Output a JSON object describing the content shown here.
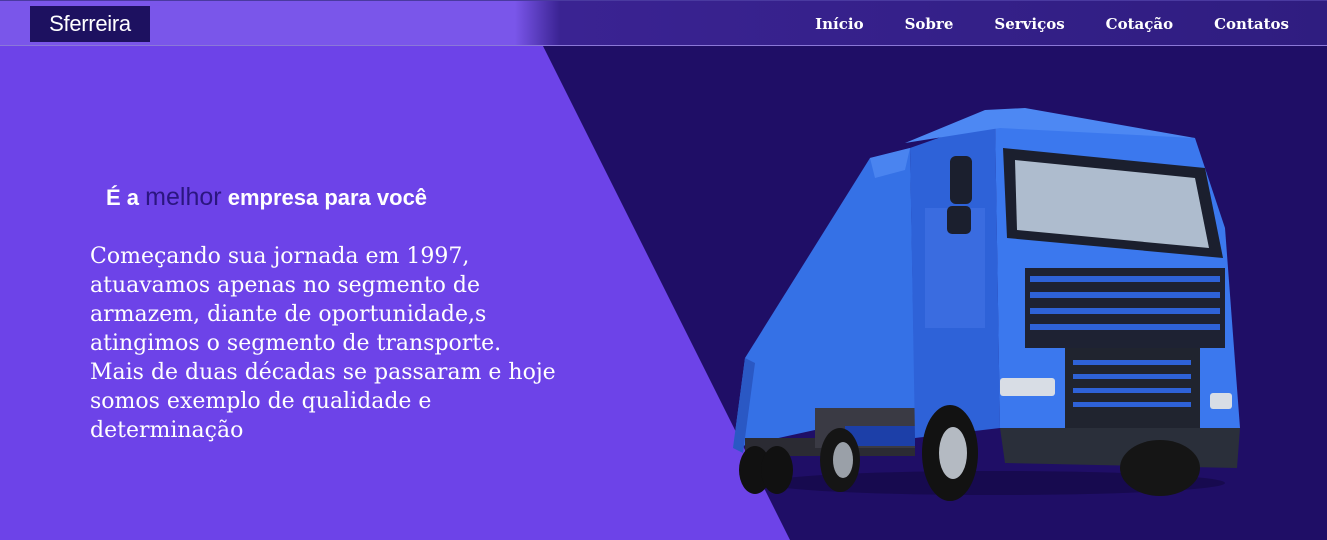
{
  "brand": {
    "logo_text": "Sferreira"
  },
  "nav": {
    "items": [
      {
        "label": "Início"
      },
      {
        "label": "Sobre"
      },
      {
        "label": "Serviços"
      },
      {
        "label": "Cotação"
      },
      {
        "label": "Contatos"
      }
    ]
  },
  "hero": {
    "headline_before": "É a",
    "headline_accent": "melhor",
    "headline_after": "empresa para você",
    "paragraph": "Começando sua jornada em 1997, atuavamos apenas no segmento de armazem, diante de oportunidade,s atingimos o segmento de transporte. Mais de duas décadas se passaram e hoje somos exemplo de qualidade e determinação"
  },
  "colors": {
    "primary_violet": "#6d43e8",
    "dark_navy": "#1f0e66",
    "accent_text": "#2b1680",
    "truck_blue": "#2f6ee8"
  },
  "icons": {
    "hero_image": "blue-truck-illustration"
  }
}
